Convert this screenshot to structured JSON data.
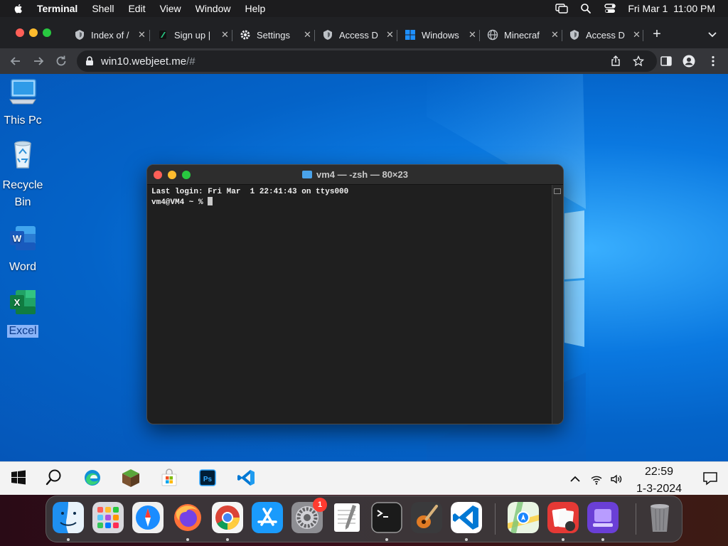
{
  "menubar": {
    "app_name": "Terminal",
    "items": [
      "Shell",
      "Edit",
      "View",
      "Window",
      "Help"
    ],
    "datetime": "Fri Mar 1  11:00 PM",
    "status_icons": [
      "screen-mirroring-icon",
      "spotlight-search-icon",
      "control-center-icon"
    ]
  },
  "browser": {
    "tabs": [
      {
        "title": "Index of /",
        "icon": "tab-favicon-icon"
      },
      {
        "title": "Sign up |",
        "icon": "tab-favicon-icon"
      },
      {
        "title": "Settings",
        "icon": "gear-icon"
      },
      {
        "title": "Access D",
        "icon": "tab-favicon-icon"
      },
      {
        "title": "Windows",
        "icon": "windows-logo-icon"
      },
      {
        "title": "Minecraf",
        "icon": "globe-icon"
      },
      {
        "title": "Access D",
        "icon": "tab-favicon-icon"
      }
    ],
    "close_glyph": "✕",
    "new_tab_glyph": "+",
    "url_host": "win10.webjeet.me",
    "url_path": "/#"
  },
  "desktop": {
    "icons": [
      {
        "label": "This Pc",
        "icon": "computer-icon"
      },
      {
        "label": "Recycle Bin",
        "icon": "recycle-bin-icon"
      },
      {
        "label": "Word",
        "icon": "word-icon"
      },
      {
        "label": "Excel",
        "icon": "excel-icon",
        "selected": true
      }
    ]
  },
  "terminal": {
    "title": "vm4 — -zsh — 80×23",
    "line1": "Last login: Fri Mar  1 22:41:43 on ttys000",
    "prompt": "vm4@VM4 ~ % "
  },
  "taskbar": {
    "apps": [
      "windows-start-icon",
      "search-icon",
      "edge-icon",
      "minecraft-icon",
      "store-icon",
      "photoshop-icon",
      "vscode-icon"
    ],
    "time": "22:59",
    "date": "1-3-2024"
  },
  "dock": {
    "apps": [
      "finder-icon",
      "launchpad-icon",
      "safari-icon",
      "firefox-icon",
      "chrome-icon",
      "app-store-icon",
      "system-settings-icon",
      "textedit-icon",
      "terminal-icon",
      "garageband-icon",
      "vscode-icon",
      "maps-icon",
      "photo-booth-icon",
      "simulator-icon",
      "trash-icon"
    ],
    "settings_badge": "1"
  },
  "colors": {
    "menubar_bg": "#1c1c1e",
    "chrome_tabstrip": "#202124",
    "chrome_toolbar": "#35363a",
    "desktop_blue": "#0a78e0",
    "terminal_bg": "#1f1f1f",
    "taskbar_bg": "#f3f3f3"
  }
}
